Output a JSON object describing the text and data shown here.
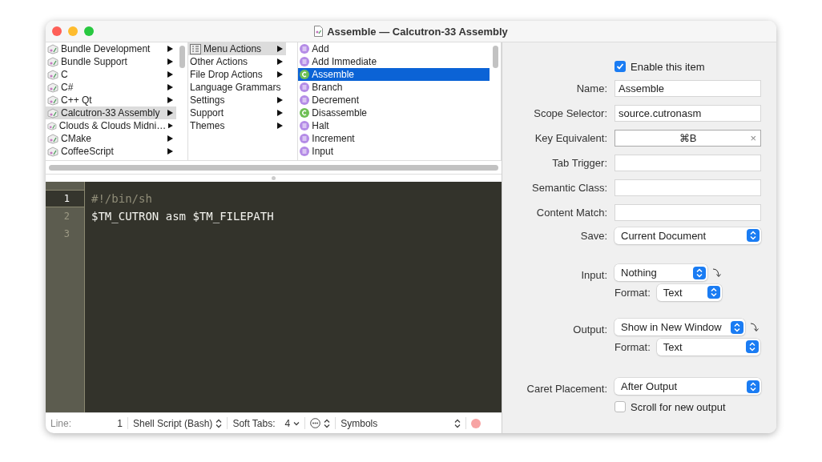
{
  "window": {
    "title": "Assemble — Calcutron-33 Assembly"
  },
  "browser": {
    "columns": [
      {
        "focused": false,
        "items": [
          {
            "label": "Bundle Development",
            "kind": "bundle",
            "selected": false
          },
          {
            "label": "Bundle Support",
            "kind": "bundle",
            "selected": false
          },
          {
            "label": "C",
            "kind": "bundle",
            "selected": false
          },
          {
            "label": "C#",
            "kind": "bundle",
            "selected": false
          },
          {
            "label": "C++ Qt",
            "kind": "bundle",
            "selected": false
          },
          {
            "label": "Calcutron-33 Assembly",
            "kind": "bundle",
            "selected": true
          },
          {
            "label": "Clouds & Clouds Midni…",
            "kind": "bundle",
            "selected": false
          },
          {
            "label": "CMake",
            "kind": "bundle",
            "selected": false
          },
          {
            "label": "CoffeeScript",
            "kind": "bundle",
            "selected": false
          }
        ]
      },
      {
        "focused": false,
        "items": [
          {
            "label": "Menu Actions",
            "kind": "menu",
            "selected": true
          },
          {
            "label": "Other Actions",
            "kind": "plain",
            "selected": false
          },
          {
            "label": "File Drop Actions",
            "kind": "plain",
            "selected": false
          },
          {
            "label": "Language Grammars",
            "kind": "plain",
            "selected": false
          },
          {
            "label": "Settings",
            "kind": "plain",
            "selected": false
          },
          {
            "label": "Support",
            "kind": "plain",
            "selected": false
          },
          {
            "label": "Themes",
            "kind": "plain",
            "selected": false
          }
        ]
      },
      {
        "focused": true,
        "items": [
          {
            "label": "Add",
            "kind": "snippet",
            "selected": false
          },
          {
            "label": "Add Immediate",
            "kind": "snippet",
            "selected": false
          },
          {
            "label": "Assemble",
            "kind": "command",
            "selected": true
          },
          {
            "label": "Branch",
            "kind": "snippet",
            "selected": false
          },
          {
            "label": "Decrement",
            "kind": "snippet",
            "selected": false
          },
          {
            "label": "Disassemble",
            "kind": "command",
            "selected": false
          },
          {
            "label": "Halt",
            "kind": "snippet",
            "selected": false
          },
          {
            "label": "Increment",
            "kind": "snippet",
            "selected": false
          },
          {
            "label": "Input",
            "kind": "snippet",
            "selected": false
          }
        ]
      }
    ]
  },
  "editor": {
    "lines": [
      {
        "number": "1",
        "text": "#!/bin/sh",
        "kind": "comment",
        "current": true
      },
      {
        "number": "2",
        "text": "$TM_CUTRON asm $TM_FILEPATH",
        "kind": "code",
        "current": false
      },
      {
        "number": "3",
        "kind": "code",
        "current": false
      }
    ]
  },
  "status_bar": {
    "line_label": "Line:",
    "line": "1",
    "language": "Shell Script (Bash)",
    "tabs_label": "Soft Tabs:",
    "tabs": "4",
    "symbols": "Symbols"
  },
  "inspector": {
    "enabled": {
      "label": "Enable this item",
      "checked": true
    },
    "fields": [
      {
        "label": "Name:",
        "value": "Assemble",
        "kind": "text"
      },
      {
        "label": "Scope Selector:",
        "value": "source.cutronasm",
        "kind": "text"
      },
      {
        "label": "Key Equivalent:",
        "value": "⌘B",
        "kind": "key",
        "clear": "×"
      },
      {
        "label": "Tab Trigger:",
        "kind": "text"
      },
      {
        "label": "Semantic Class:",
        "kind": "text"
      },
      {
        "label": "Content Match:",
        "kind": "text"
      }
    ],
    "save": {
      "label": "Save:",
      "value": "Current Document"
    },
    "input": {
      "label": "Input:",
      "value": "Nothing",
      "format_label": "Format:",
      "format": "Text"
    },
    "output": {
      "label": "Output:",
      "value": "Show in New Window",
      "format_label": "Format:",
      "format": "Text"
    },
    "caret": {
      "label": "Caret Placement:",
      "value": "After Output"
    },
    "scroll": {
      "label": "Scroll for new output",
      "checked": false
    }
  }
}
